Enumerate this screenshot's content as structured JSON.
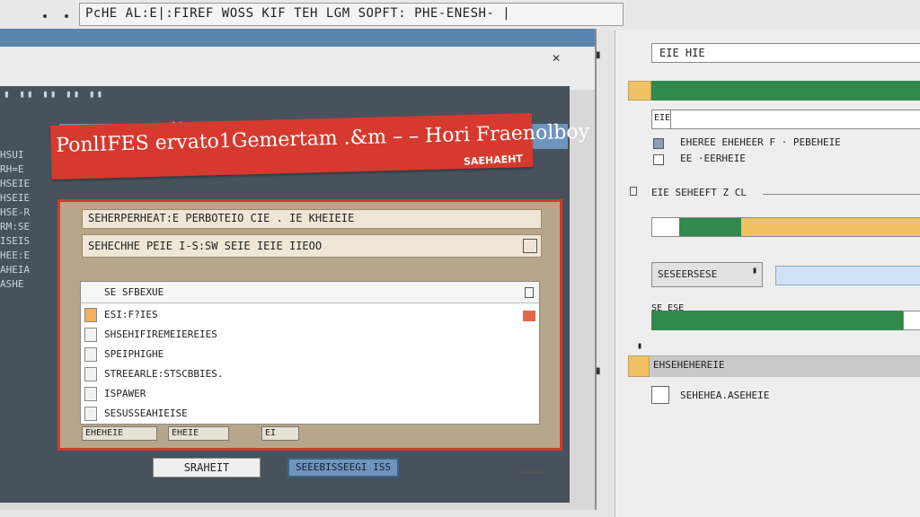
{
  "top_bar": {
    "title": "PcHE AL:E|:FIREF WOSS KIF TEH LGM SOPFT: PHE-ENESH- |"
  },
  "window": {
    "close_glyph": "✕",
    "dark_toolbar": "▮ ▮▮ ▮▮ ▮▮ ▮▮",
    "dark_columns": [
      "HSUI",
      "RH=E",
      "HSEIE",
      "HSEIE",
      "HSE-R",
      "RM:SE",
      "ISEIS",
      "HEE:E",
      "AHEIA",
      "ASHE"
    ],
    "blue_strip_text": "▮▮ ▮▮ ▮▮▮▮▮ ▮ ▮▮ ▮▮▮ ▮▮ ▮▮▮▮ ▮▮▮▮"
  },
  "banner": {
    "title": "PonlIFES ervato1Gemertam  .&m – – Hori Fraenolboy",
    "subtitle": "SAEHAEHT"
  },
  "dialog": {
    "field1": "SEHERPERHEAT:E PERBOTEIO CIE .   IE   KHEIEIE",
    "field2": "SEHECHHE PEIE I-S:SW  SEIE IEIE IIEOO",
    "list_header": "SE SFBEXUE",
    "list_items": [
      "ESI:F?IES",
      "SHSEHIFIREMEIEREIES",
      "SPEIPHIGHE",
      "STREEARLE:STSCBBIES.",
      "ISPAWER",
      "SESUSSEAHIEISE"
    ],
    "footer": [
      "EHEHEIE",
      "EHEIE",
      "EI"
    ]
  },
  "buttons": {
    "left": "SRAHEIT",
    "right": "SEEEBISSEEGI ISS"
  },
  "right_panel": {
    "field1": "EIE HIE",
    "field2_lead": "EIE",
    "check1_label": "EHEREE EHEHEER F · PEBEHEIE",
    "check2_label": "EE ·EERHEIE",
    "section1": "EIE SEHEEFT Z CL",
    "button_label": "SESEERSESE",
    "label_row": "SE ESE",
    "gray_row_label": "EHSEHEHEREIE",
    "checkbox3_label": "SEHEHEA.ASEHEIE",
    "edge_mark": "▮",
    "progress": 0.33
  },
  "colors": {
    "accent_red": "#d63a2e",
    "blue": "#6f94bd",
    "green": "#2f8a4c",
    "yellow": "#f2c262"
  }
}
